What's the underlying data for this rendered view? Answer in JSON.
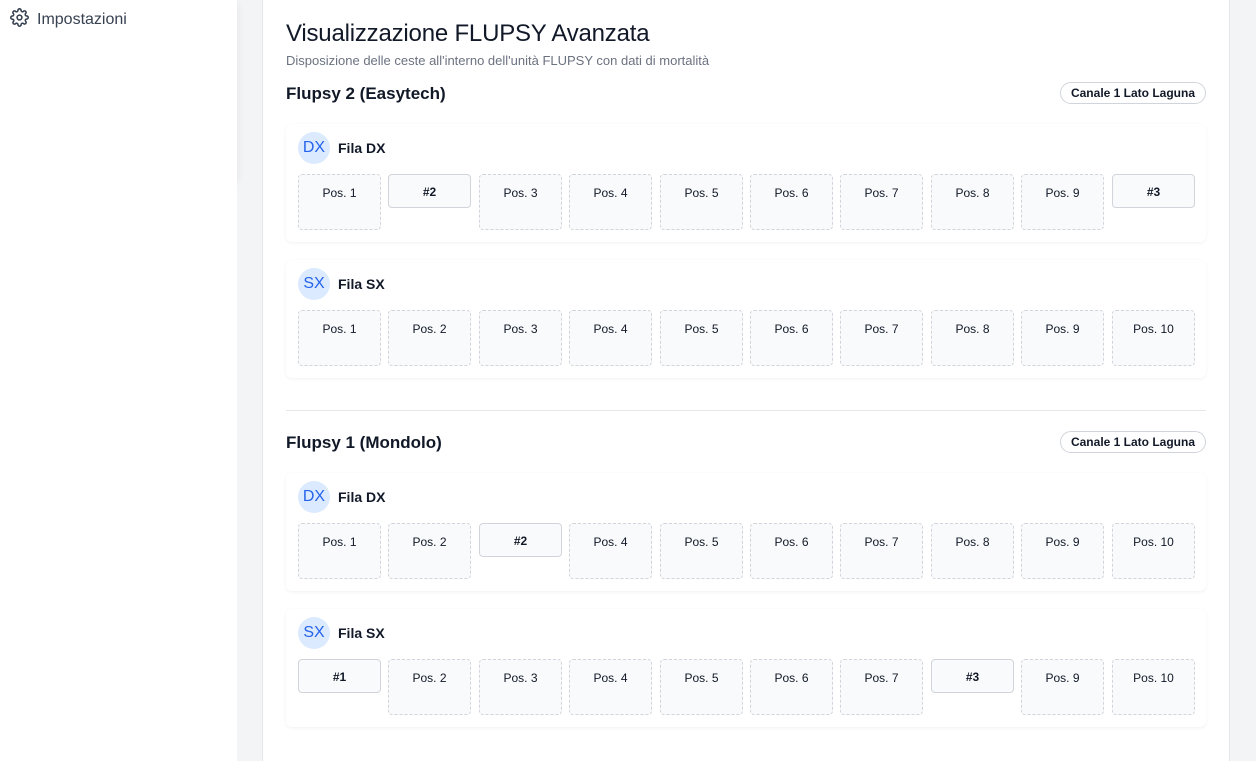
{
  "sidebar": {
    "settings_label": "Impostazioni"
  },
  "page": {
    "title": "Visualizzazione FLUPSY Avanzata",
    "subtitle": "Disposizione delle ceste all'interno dell'unità FLUPSY con dati di mortalità"
  },
  "flupsys": [
    {
      "name": "Flupsy 2 (Easytech)",
      "badge": "Canale 1 Lato Laguna",
      "rows": [
        {
          "avatar": "DX",
          "label": "Fila DX",
          "positions": [
            {
              "label": "Pos. 1",
              "basket": false
            },
            {
              "label": "#2",
              "basket": true
            },
            {
              "label": "Pos. 3",
              "basket": false
            },
            {
              "label": "Pos. 4",
              "basket": false
            },
            {
              "label": "Pos. 5",
              "basket": false
            },
            {
              "label": "Pos. 6",
              "basket": false
            },
            {
              "label": "Pos. 7",
              "basket": false
            },
            {
              "label": "Pos. 8",
              "basket": false
            },
            {
              "label": "Pos. 9",
              "basket": false
            },
            {
              "label": "#3",
              "basket": true
            }
          ]
        },
        {
          "avatar": "SX",
          "label": "Fila SX",
          "positions": [
            {
              "label": "Pos. 1",
              "basket": false
            },
            {
              "label": "Pos. 2",
              "basket": false
            },
            {
              "label": "Pos. 3",
              "basket": false
            },
            {
              "label": "Pos. 4",
              "basket": false
            },
            {
              "label": "Pos. 5",
              "basket": false
            },
            {
              "label": "Pos. 6",
              "basket": false
            },
            {
              "label": "Pos. 7",
              "basket": false
            },
            {
              "label": "Pos. 8",
              "basket": false
            },
            {
              "label": "Pos. 9",
              "basket": false
            },
            {
              "label": "Pos. 10",
              "basket": false
            }
          ]
        }
      ]
    },
    {
      "name": "Flupsy 1 (Mondolo)",
      "badge": "Canale 1 Lato Laguna",
      "rows": [
        {
          "avatar": "DX",
          "label": "Fila DX",
          "positions": [
            {
              "label": "Pos. 1",
              "basket": false
            },
            {
              "label": "Pos. 2",
              "basket": false
            },
            {
              "label": "#2",
              "basket": true
            },
            {
              "label": "Pos. 4",
              "basket": false
            },
            {
              "label": "Pos. 5",
              "basket": false
            },
            {
              "label": "Pos. 6",
              "basket": false
            },
            {
              "label": "Pos. 7",
              "basket": false
            },
            {
              "label": "Pos. 8",
              "basket": false
            },
            {
              "label": "Pos. 9",
              "basket": false
            },
            {
              "label": "Pos. 10",
              "basket": false
            }
          ]
        },
        {
          "avatar": "SX",
          "label": "Fila SX",
          "positions": [
            {
              "label": "#1",
              "basket": true
            },
            {
              "label": "Pos. 2",
              "basket": false
            },
            {
              "label": "Pos. 3",
              "basket": false
            },
            {
              "label": "Pos. 4",
              "basket": false
            },
            {
              "label": "Pos. 5",
              "basket": false
            },
            {
              "label": "Pos. 6",
              "basket": false
            },
            {
              "label": "Pos. 7",
              "basket": false
            },
            {
              "label": "#3",
              "basket": true
            },
            {
              "label": "Pos. 9",
              "basket": false
            },
            {
              "label": "Pos. 10",
              "basket": false
            }
          ]
        }
      ]
    }
  ]
}
